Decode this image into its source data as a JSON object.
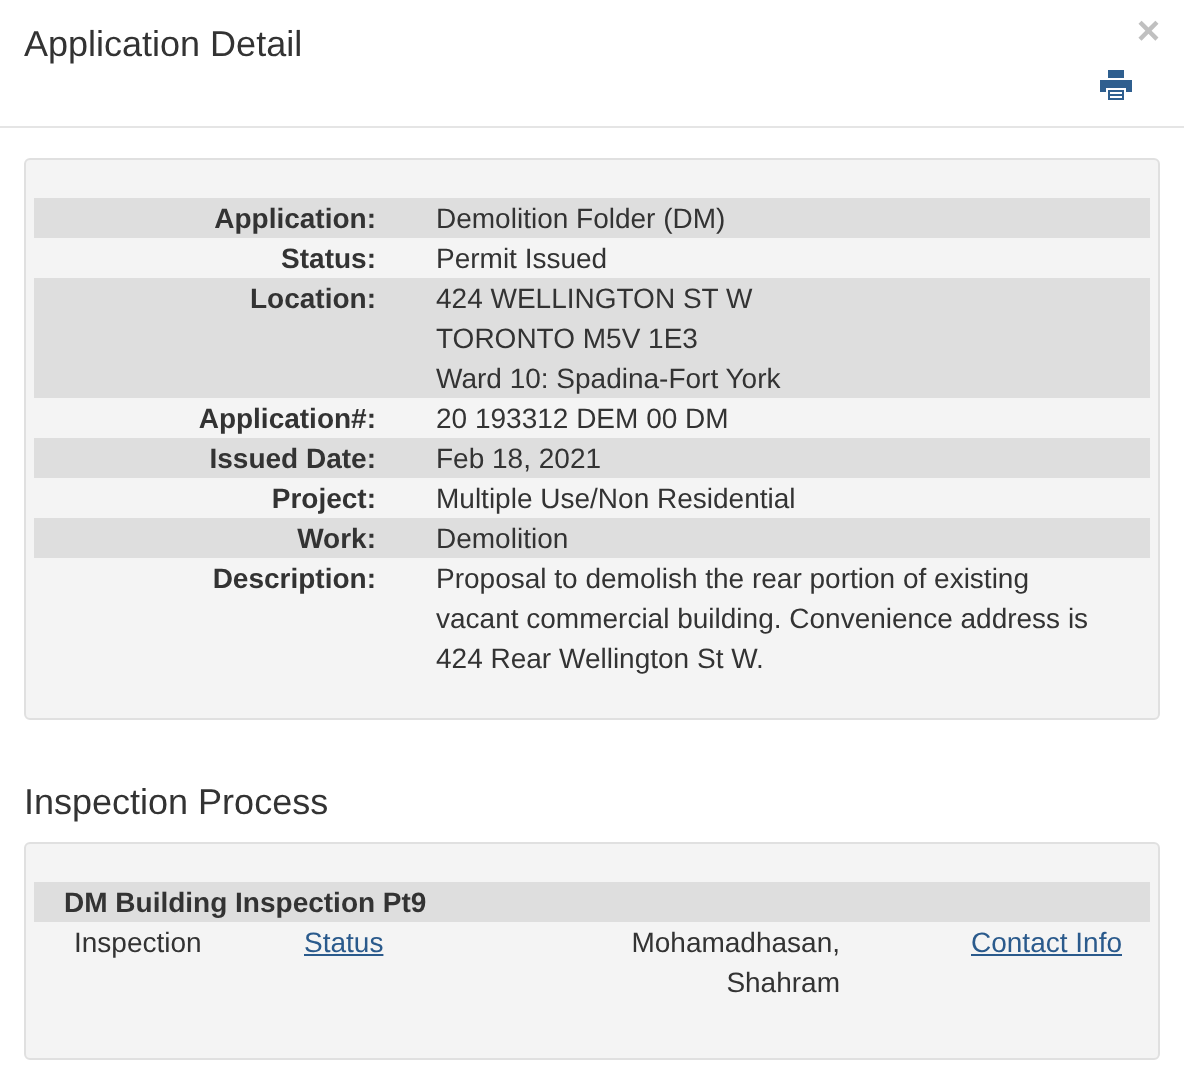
{
  "header": {
    "title": "Application Detail",
    "close": "×"
  },
  "details": [
    {
      "label": "Application:",
      "lines": [
        "Demolition Folder (DM)"
      ]
    },
    {
      "label": "Status:",
      "lines": [
        "Permit Issued"
      ]
    },
    {
      "label": "Location:",
      "lines": [
        "424 WELLINGTON ST W",
        "TORONTO M5V 1E3",
        "Ward 10: Spadina-Fort York"
      ]
    },
    {
      "label": "Application#:",
      "lines": [
        "20 193312 DEM 00 DM"
      ]
    },
    {
      "label": "Issued Date:",
      "lines": [
        "Feb 18, 2021"
      ]
    },
    {
      "label": "Project:",
      "lines": [
        "Multiple Use/Non Residential"
      ]
    },
    {
      "label": "Work:",
      "lines": [
        "Demolition"
      ]
    },
    {
      "label": "Description:",
      "lines": [
        "Proposal to demolish the rear portion of existing vacant commercial building. Convenience address is 424 Rear Wellington St W."
      ]
    }
  ],
  "inspection": {
    "heading": "Inspection Process",
    "group": "DM Building Inspection Pt9",
    "rows": [
      {
        "type": "Inspection",
        "status_link": "Status",
        "inspector": "Mohamadhasan,\nShahram",
        "contact_link": "Contact Info"
      }
    ]
  }
}
